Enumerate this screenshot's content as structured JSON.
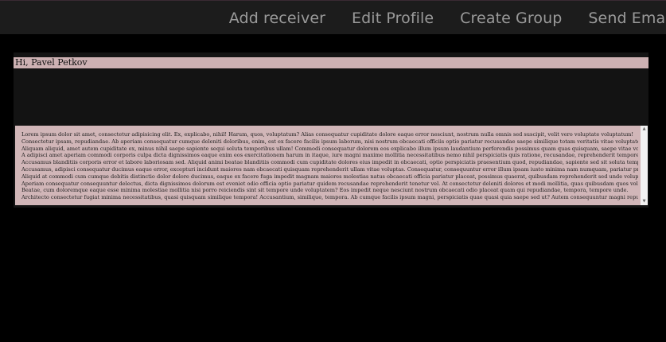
{
  "nav": {
    "items": [
      {
        "label": "Add receiver"
      },
      {
        "label": "Edit Profile"
      },
      {
        "label": "Create Group"
      },
      {
        "label": "Send Email"
      }
    ]
  },
  "greeting": "Hi, Pavel Petkov",
  "content": {
    "lines": [
      "Lorem ipsum dolor sit amet, consectetur adipisicing elit. Ex, explicabo, nihil! Harum, quos, voluptatum? Alias consequatur cupiditate dolore eaque error nesciunt, nostrum nulla omnis sed suscipit, velit vero voluptate voluptatum!",
      "Consectetur ipsam, repudiandae. Ab aperiam consequatur cumque deleniti doloribus, enim, est ex facere facilis ipsum laborum, nisi nostrum obcaecati officiis optio pariatur recusandae saepe similique totam veritatis vitae voluptates voluptatum.",
      "Aliquam aliquid, amet autem cupiditate ex, minus nihil saepe sapiente sequi soluta temporibus ullam! Commodi consequatur dolorem eos explicabo illum ipsum laudantium perferendis possimus quam quas quisquam, saepe vitae voluptatem?",
      "A adipisci amet aperiam commodi corporis culpa dicta dignissimos eaque enim eos exercitationem harum in itaque, iure magni maxime mollitia necessitatibus nemo nihil perspiciatis quis ratione, recusandae, reprehenderit tempore voluptatem!",
      "Accusamus blanditiis corporis error et labore laboriosam sed. Aliquid animi beatae blanditiis commodi cum cupiditate dolores eius impedit in obcaecati, optio perspiciatis praesentium quod, repudiandae, sapiente sed sit soluta tempore.",
      "Accusamus, adipisci consequatur ducimus eaque error, excepturi incidunt maiores nam obcaecati quisquam reprehenderit ullam vitae voluptas. Consequatur, consequuntur error illum ipsam iusto minima nam numquam, pariatur praesentium quasi tempora voluptatum?",
      "Aliquid at commodi cum cumque debitis distinctio dolor dolore ducimus, eaque ex facere fuga impedit magnam maiores molestias natus obcaecati officia pariatur placeat, possimus quaerat, quibusdam reprehenderit sed unde voluptatibus.",
      "Aperiam consequatur consequuntur delectus, dicta dignissimos dolorum est eveniet odio officia optio pariatur quidem recusandae reprehenderit tenetur vel. At consectetur deleniti dolores et modi mollitia, quas quibusdam quos voluptatum. Ratione.",
      "Beatae, cum doloremque eaque esse minima molestiae mollitia nisi porro reiciendis sint sit tempore unde voluptatem? Eos impedit neque nesciunt nostrum obcaecati odio placeat quam qui repudiandae, tempora, tempore unde.",
      "Architecto consectetur fugiat minima necessitatibus, quasi quisquam similique tempora! Accusantium, similique, tempora. Ab cumque facilis ipsum magni, perspiciatis quae quasi quia saepe sed ut? Autem consequuntur magni repudiandae veniam vitae?"
    ]
  }
}
